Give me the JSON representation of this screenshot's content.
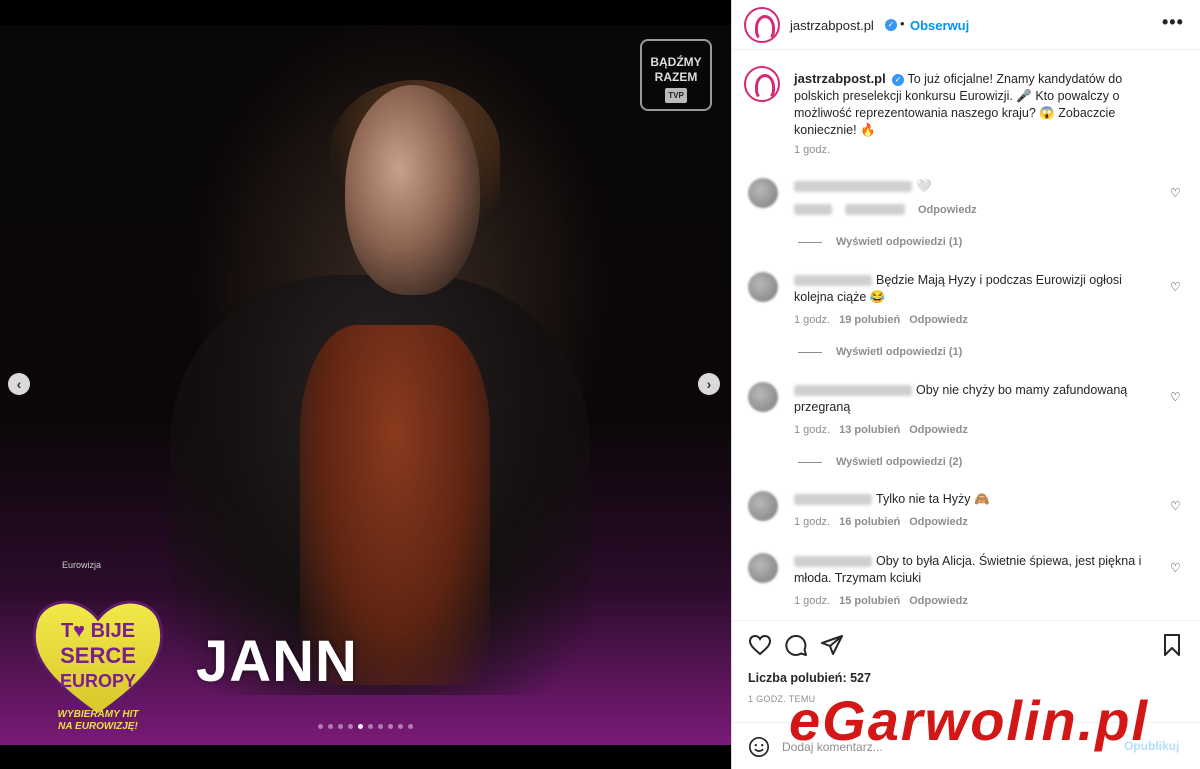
{
  "media": {
    "logo_top": [
      "BĄDŹMY",
      "RAZEM"
    ],
    "logo_top_mark": "TVP",
    "event_small": "Eurowizja",
    "heart_lines": [
      "T♥ BIJE",
      "SERCE",
      "EUROPY"
    ],
    "heart_sub": [
      "WYBIERAMY HIT",
      "NA EUROWIZJĘ!"
    ],
    "artist": "JANN",
    "slides_count": 10,
    "active_slide": 4,
    "prev_icon": "chevron-left-icon",
    "next_icon": "chevron-right-icon"
  },
  "header": {
    "username": "jastrzabpost.pl",
    "separator": "•",
    "follow_label": "Obserwuj",
    "more_icon": "more-icon",
    "more_label": "•••"
  },
  "caption": {
    "username": "jastrzabpost.pl",
    "text": "To już oficjalne! Znamy kandydatów do polskich preselekcji konkursu Eurowizji. 🎤 Kto powalczy o możliwość reprezentowania naszego kraju? 😱 Zobaczcie koniecznie! 🔥",
    "time": "1 godz."
  },
  "comments": [
    {
      "text": "🤍",
      "time": "",
      "likes": "",
      "reply": "Odpowiedz",
      "view_replies": "Wyświetl odpowiedzi (1)"
    },
    {
      "text": "Będzie Mają Hyzy i podczas Eurowizji ogłosi kolejna ciąże 😂",
      "time": "1 godz.",
      "likes": "19 polubień",
      "reply": "Odpowiedz",
      "view_replies": "Wyświetl odpowiedzi (1)"
    },
    {
      "text": "Oby nie chyży bo mamy zafundowaną przegraną",
      "time": "1 godz.",
      "likes": "13 polubień",
      "reply": "Odpowiedz",
      "view_replies": "Wyświetl odpowiedzi (2)"
    },
    {
      "text": "Tylko nie ta Hyży 🙈",
      "time": "1 godz.",
      "likes": "16 polubień",
      "reply": "Odpowiedz"
    },
    {
      "text": "Oby to była Alicja. Świetnie śpiewa, jest piękna i młoda. Trzymam kciuki",
      "time": "1 godz.",
      "likes": "15 polubień",
      "reply": "Odpowiedz"
    }
  ],
  "footer": {
    "likes": "Liczba polubień: 527",
    "posted": "1 GODZ. TEMU",
    "comment_placeholder": "Dodaj komentarz...",
    "publish_label": "Opublikuj"
  },
  "watermark": "eGarwolin.pl",
  "colors": {
    "accent": "#0095f6",
    "brand_pink": "#d62976",
    "watermark_red": "#d10a0a",
    "heart_yellow": "#e8e040"
  }
}
